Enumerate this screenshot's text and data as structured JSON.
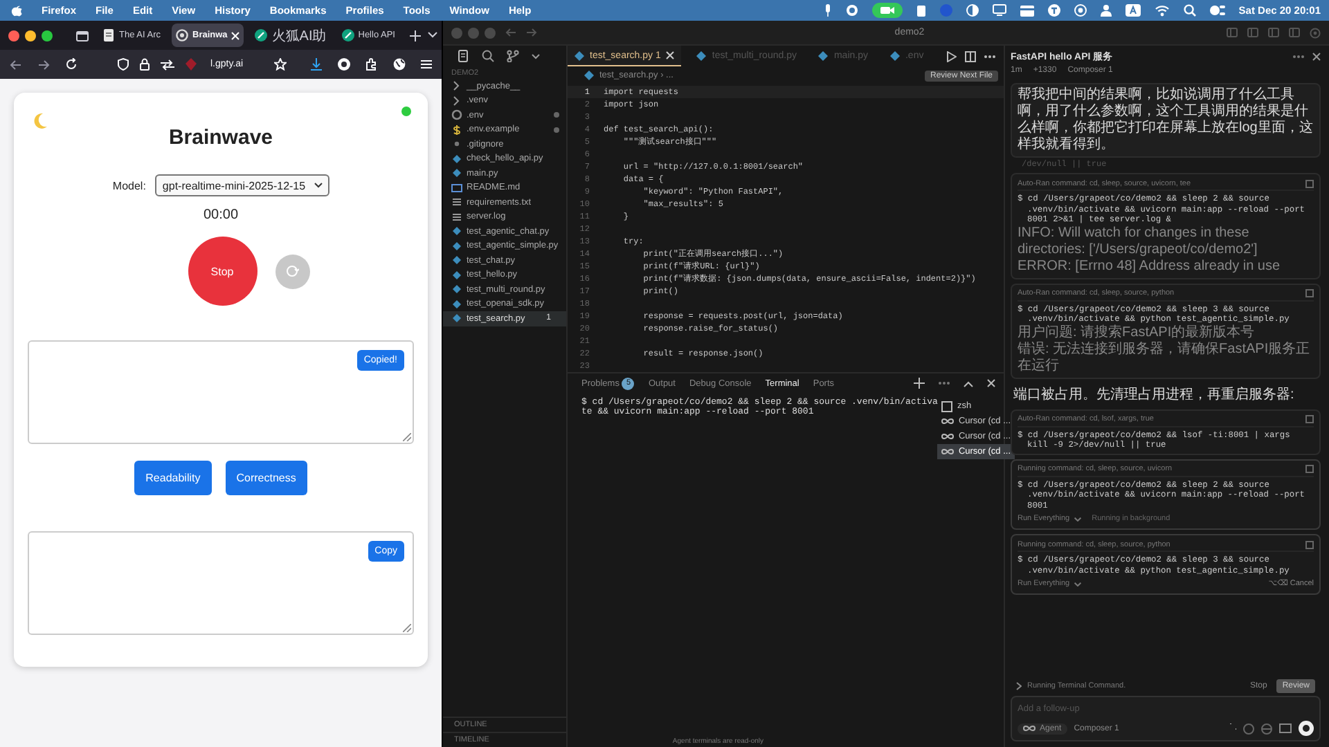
{
  "menu_bar": {
    "app": "Firefox",
    "items": [
      "File",
      "Edit",
      "View",
      "History",
      "Bookmarks",
      "Profiles",
      "Tools",
      "Window",
      "Help"
    ],
    "clock": "Sat Dec 20  20:01"
  },
  "browser": {
    "tabs": [
      {
        "label": "The AI Arc",
        "selected": false
      },
      {
        "label": "Brainwa",
        "selected": true
      },
      {
        "label": "火狐AI助",
        "selected": false
      },
      {
        "label": "Hello API",
        "selected": false
      }
    ],
    "url": "l.gpty.ai"
  },
  "app": {
    "connected": true,
    "title": "Brainwave",
    "model_label": "Model:",
    "model": "gpt-realtime-mini-2025-12-15",
    "timer": "00:00",
    "record_button": "Stop",
    "recording": true,
    "transcript_box": {
      "button": "Copied!"
    },
    "actions": [
      "Readability",
      "Correctness"
    ],
    "result_box": {
      "button": "Copy"
    }
  },
  "editor": {
    "title": "demo2",
    "explorer": {
      "title": "DEMO2",
      "files": [
        {
          "name": "__pycache__",
          "kind": "folder",
          "modified": false
        },
        {
          "name": ".venv",
          "kind": "folder",
          "modified": false
        },
        {
          "name": ".env",
          "kind": "gear",
          "modified": true
        },
        {
          "name": ".env.example",
          "kind": "dollar",
          "modified": true
        },
        {
          "name": ".gitignore",
          "kind": "plain",
          "modified": false
        },
        {
          "name": "check_hello_api.py",
          "kind": "python",
          "modified": false
        },
        {
          "name": "main.py",
          "kind": "python",
          "modified": false
        },
        {
          "name": "README.md",
          "kind": "markdown",
          "modified": false
        },
        {
          "name": "requirements.txt",
          "kind": "lines",
          "modified": false
        },
        {
          "name": "server.log",
          "kind": "lines",
          "modified": false
        },
        {
          "name": "test_agentic_chat.py",
          "kind": "python",
          "modified": false
        },
        {
          "name": "test_agentic_simple.py",
          "kind": "python",
          "modified": false
        },
        {
          "name": "test_chat.py",
          "kind": "python",
          "modified": false
        },
        {
          "name": "test_hello.py",
          "kind": "python",
          "modified": false
        },
        {
          "name": "test_multi_round.py",
          "kind": "python",
          "modified": false
        },
        {
          "name": "test_openai_sdk.py",
          "kind": "python",
          "modified": false
        },
        {
          "name": "test_search.py",
          "kind": "python",
          "modified": false,
          "badge": "1",
          "selected": true
        }
      ],
      "sections": [
        "OUTLINE",
        "TIMELINE"
      ]
    },
    "tabs": [
      {
        "label": "test_search.py",
        "badge": "1",
        "selected": true
      },
      {
        "label": "test_multi_round.py",
        "selected": false
      },
      {
        "label": "main.py",
        "selected": false
      },
      {
        "label": ".env",
        "selected": false
      }
    ],
    "breadcrumb": "test_search.py › ...",
    "tooltip": "Review Next File",
    "code": [
      {
        "line": "1",
        "text": "import requests"
      },
      {
        "line": "2",
        "text": "import json"
      },
      {
        "line": "3"
      },
      {
        "line": "4",
        "text": "def test_search_api():"
      },
      {
        "line": "5",
        "text": "    \"\"\"测试search接口\"\"\""
      },
      {
        "line": "6"
      },
      {
        "line": "7",
        "text": "    url = \"http://127.0.0.1:8001/search\""
      },
      {
        "line": "8",
        "text": "    data = {"
      },
      {
        "line": "9",
        "text": "        \"keyword\": \"Python FastAPI\","
      },
      {
        "line": "10",
        "text": "        \"max_results\": 5"
      },
      {
        "line": "11",
        "text": "    }"
      },
      {
        "line": "12"
      },
      {
        "line": "13",
        "text": "    try:"
      },
      {
        "line": "14",
        "text": "        print(\"正在调用search接口...\")"
      },
      {
        "line": "15",
        "text": "        print(f\"请求URL: {url}\")"
      },
      {
        "line": "16",
        "text": "        print(f\"请求数据: {json.dumps(data, ensure_ascii=False, indent=2)}\")"
      },
      {
        "line": "17",
        "text": "        print()"
      },
      {
        "line": "18"
      },
      {
        "line": "19",
        "text": "        response = requests.post(url, json=data)"
      },
      {
        "line": "20",
        "text": "        response.raise_for_status()"
      },
      {
        "line": "21"
      },
      {
        "line": "22",
        "text": "        result = response.json()"
      },
      {
        "line": "23"
      }
    ],
    "panel": {
      "tabs": [
        {
          "label": "Problems",
          "badge": "5",
          "selected": false
        },
        {
          "label": "Output",
          "selected": false
        },
        {
          "label": "Debug Console",
          "selected": false
        },
        {
          "label": "Terminal",
          "selected": true
        },
        {
          "label": "Ports",
          "selected": false
        }
      ],
      "terminal": [
        "$ cd /Users/grapeot/co/demo2 && sleep 2 && source .venv/bin/activa",
        "te && uvicorn main:app --reload --port 8001"
      ],
      "sessions": [
        {
          "label": "zsh",
          "kind": "shell",
          "selected": false
        },
        {
          "label": "Cursor (cd ...",
          "kind": "agent",
          "selected": false
        },
        {
          "label": "Cursor (cd ...",
          "kind": "agent",
          "selected": false
        },
        {
          "label": "Cursor (cd ...",
          "kind": "agent",
          "selected": true
        }
      ],
      "footer": "Agent terminals are read-only"
    }
  },
  "chat": {
    "title": "FastAPI hello API 服务",
    "meta": [
      "1m",
      "+1330",
      "Composer 1"
    ],
    "items": [
      {
        "kind": "message",
        "text": "帮我把中间的结果啊，比如说调用了什么工具啊，用了什么参数啊，这个工具调用的结果是什么样啊，你都把它打印在屏幕上放在log里面，这样我就看得到。"
      },
      {
        "kind": "fragment",
        "text": "/dev/null || true"
      },
      {
        "kind": "command",
        "header": "Auto-Ran command: cd, sleep, source, uvicorn, tee",
        "command": "$ cd /Users/grapeot/co/demo2 && sleep 2 && source .venv/bin/activate && uvicorn main:app --reload --port 8001 2>&1 | tee server.log &",
        "output": [
          "INFO:     Will watch for changes in these directories: ['/Users/grapeot/co/demo2']",
          "ERROR:    [Errno 48] Address already in use"
        ]
      },
      {
        "kind": "command",
        "header": "Auto-Ran command: cd, sleep, source, python",
        "command": "$ cd /Users/grapeot/co/demo2 && sleep 3 && source .venv/bin/activate && python test_agentic_simple.py",
        "output": [
          "用户问题: 请搜索FastAPI的最新版本号",
          "错误: 无法连接到服务器，请确保FastAPI服务正在运行"
        ]
      },
      {
        "kind": "reply",
        "text": "端口被占用。先清理占用进程，再重启服务器:"
      },
      {
        "kind": "command",
        "header": "Auto-Ran command: cd, lsof, xargs, true",
        "command": "$ cd /Users/grapeot/co/demo2 && lsof -ti:8001 | xargs kill -9 2>/dev/null || true"
      },
      {
        "kind": "command",
        "header": "Running command: cd, sleep, source, uvicorn",
        "command": "$ cd /Users/grapeot/co/demo2 && sleep 2 && source .venv/bin/activate && uvicorn main:app --reload --port 8001",
        "footer": "Run Everything",
        "note": "Running in background"
      },
      {
        "kind": "command",
        "header": "Running command: cd, sleep, source, python",
        "command": "$ cd /Users/grapeot/co/demo2 && sleep 3 && source .venv/bin/activate && python test_agentic_simple.py",
        "footer": "Run Everything",
        "action": "⌥⌫ Cancel"
      }
    ],
    "status": "Running Terminal Command.",
    "stop": "Stop",
    "review": "Review",
    "placeholder": "Add a follow-up",
    "mode": "Agent",
    "model": "Composer 1"
  }
}
